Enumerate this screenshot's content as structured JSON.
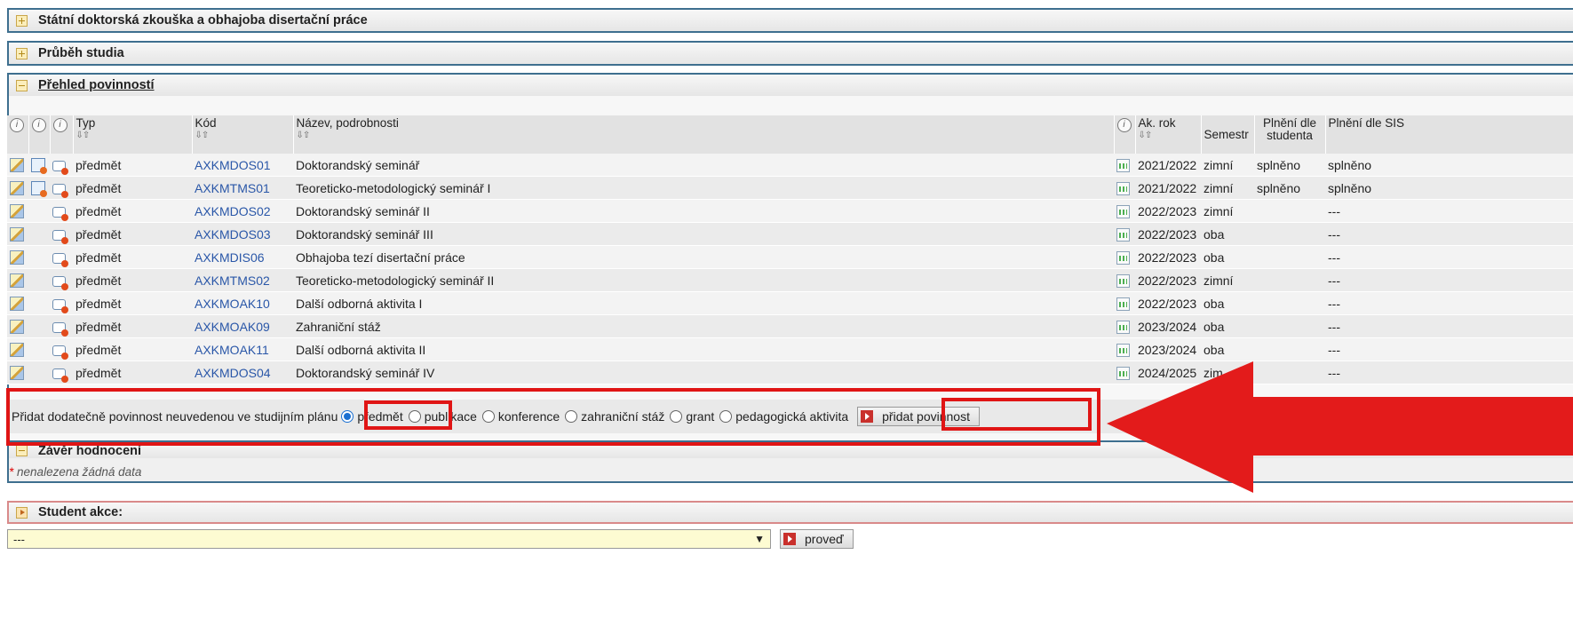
{
  "sections": {
    "state_exam": "Státní doktorská zkouška a obhajoba disertační práce",
    "progress": "Průběh studia",
    "overview": "Přehled povinností",
    "conclusion": "Závěr hodnocení",
    "no_data": "nenalezena žádná data",
    "student_action": "Student akce:"
  },
  "table": {
    "headers": {
      "type": "Typ",
      "code": "Kód",
      "name": "Název, podrobnosti",
      "year": "Ak. rok",
      "semester": "Semestr",
      "student": "Plnění dle studenta",
      "sis": "Plnění dle SIS"
    },
    "rows": [
      {
        "type": "předmět",
        "code": "AXKMDOS01",
        "name": "Doktorandský seminář",
        "year": "2021/2022",
        "sem": "zimní",
        "student": "splněno",
        "sis": "splněno"
      },
      {
        "type": "předmět",
        "code": "AXKMTMS01",
        "name": "Teoreticko-metodologický seminář I",
        "year": "2021/2022",
        "sem": "zimní",
        "student": "splněno",
        "sis": "splněno"
      },
      {
        "type": "předmět",
        "code": "AXKMDOS02",
        "name": "Doktorandský seminář II",
        "year": "2022/2023",
        "sem": "zimní",
        "student": "",
        "sis": "---"
      },
      {
        "type": "předmět",
        "code": "AXKMDOS03",
        "name": "Doktorandský seminář III",
        "year": "2022/2023",
        "sem": "oba",
        "student": "",
        "sis": "---"
      },
      {
        "type": "předmět",
        "code": "AXKMDIS06",
        "name": "Obhajoba tezí disertační práce",
        "year": "2022/2023",
        "sem": "oba",
        "student": "",
        "sis": "---"
      },
      {
        "type": "předmět",
        "code": "AXKMTMS02",
        "name": "Teoreticko-metodologický seminář II",
        "year": "2022/2023",
        "sem": "zimní",
        "student": "",
        "sis": "---"
      },
      {
        "type": "předmět",
        "code": "AXKMOAK10",
        "name": "Další odborná aktivita I",
        "year": "2022/2023",
        "sem": "oba",
        "student": "",
        "sis": "---"
      },
      {
        "type": "předmět",
        "code": "AXKMOAK09",
        "name": "Zahraniční stáž",
        "year": "2023/2024",
        "sem": "oba",
        "student": "",
        "sis": "---"
      },
      {
        "type": "předmět",
        "code": "AXKMOAK11",
        "name": "Další odborná aktivita II",
        "year": "2023/2024",
        "sem": "oba",
        "student": "",
        "sis": "---"
      },
      {
        "type": "předmět",
        "code": "AXKMDOS04",
        "name": "Doktorandský seminář IV",
        "year": "2024/2025",
        "sem": "zim",
        "student": "",
        "sis": "---"
      }
    ]
  },
  "add": {
    "label": "Přidat dodatečně povinnost neuvedenou ve studijním plánu",
    "options": [
      "předmět",
      "publikace",
      "konference",
      "zahraniční stáž",
      "grant",
      "pedagogická aktivita"
    ],
    "selected": "předmět",
    "button": "přidat povinnost"
  },
  "action": {
    "select_value": "---",
    "button": "proveď"
  },
  "annotation": {
    "arrow_color": "#e31b1b",
    "box_color": "#e01515"
  }
}
